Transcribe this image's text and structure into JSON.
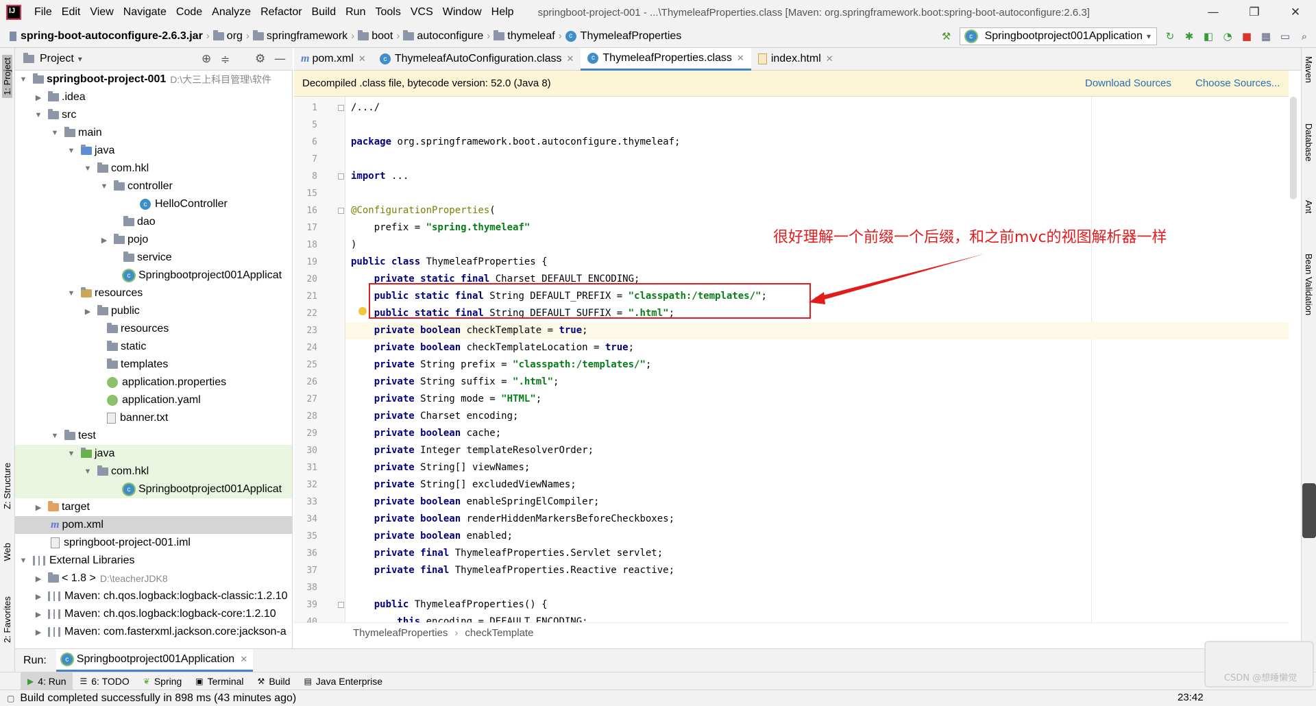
{
  "menubar": {
    "items": [
      "File",
      "Edit",
      "View",
      "Navigate",
      "Code",
      "Analyze",
      "Refactor",
      "Build",
      "Run",
      "Tools",
      "VCS",
      "Window",
      "Help"
    ],
    "title": "springboot-project-001 - ...\\ThymeleafProperties.class [Maven: org.springframework.boot:spring-boot-autoconfigure:2.6.3]"
  },
  "navbar": {
    "crumbs": [
      "spring-boot-autoconfigure-2.6.3.jar",
      "org",
      "springframework",
      "boot",
      "autoconfigure",
      "thymeleaf",
      "ThymeleafProperties"
    ],
    "run_config": "Springbootproject001Application"
  },
  "project": {
    "title": "Project",
    "nodes": [
      {
        "label": "springboot-project-001",
        "extra": "D:\\大三上科目管理\\软件"
      },
      {
        "label": ".idea"
      },
      {
        "label": "src"
      },
      {
        "label": "main"
      },
      {
        "label": "java"
      },
      {
        "label": "com.hkl"
      },
      {
        "label": "controller"
      },
      {
        "label": "HelloController"
      },
      {
        "label": "dao"
      },
      {
        "label": "pojo"
      },
      {
        "label": "service"
      },
      {
        "label": "Springbootproject001Applicat"
      },
      {
        "label": "resources"
      },
      {
        "label": "public"
      },
      {
        "label": "resources"
      },
      {
        "label": "static"
      },
      {
        "label": "templates"
      },
      {
        "label": "application.properties"
      },
      {
        "label": "application.yaml"
      },
      {
        "label": "banner.txt"
      },
      {
        "label": "test"
      },
      {
        "label": "java"
      },
      {
        "label": "com.hkl"
      },
      {
        "label": "Springbootproject001Applicat"
      },
      {
        "label": "target"
      },
      {
        "label": "pom.xml"
      },
      {
        "label": "springboot-project-001.iml"
      },
      {
        "label": "External Libraries"
      },
      {
        "label": "< 1.8 >",
        "extra": "D:\\teacherJDK8"
      },
      {
        "label": "Maven: ch.qos.logback:logback-classic:1.2.10"
      },
      {
        "label": "Maven: ch.qos.logback:logback-core:1.2.10"
      },
      {
        "label": "Maven: com.fasterxml.jackson.core:jackson-a"
      }
    ]
  },
  "tabs": [
    {
      "label": "pom.xml"
    },
    {
      "label": "ThymeleafAutoConfiguration.class"
    },
    {
      "label": "ThymeleafProperties.class"
    },
    {
      "label": "index.html"
    }
  ],
  "banner": {
    "text": "Decompiled .class file, bytecode version: 52.0 (Java 8)",
    "download": "Download Sources",
    "choose": "Choose Sources..."
  },
  "code": {
    "line_numbers": [
      "1",
      "5",
      "6",
      "7",
      "8",
      "15",
      "16",
      "17",
      "18",
      "19",
      "20",
      "21",
      "22",
      "23",
      "24",
      "25",
      "26",
      "27",
      "28",
      "29",
      "30",
      "31",
      "32",
      "33",
      "34",
      "35",
      "36",
      "37",
      "38",
      "39",
      "40"
    ],
    "lines": [
      [
        [
          "",
          "/.../"
        ]
      ],
      [],
      [
        [
          "k",
          "package "
        ],
        [
          "",
          "org.springframework.boot.autoconfigure.thymeleaf;"
        ]
      ],
      [],
      [
        [
          "k",
          "import "
        ],
        [
          "",
          "..."
        ]
      ],
      [],
      [
        [
          "a",
          "@ConfigurationProperties"
        ],
        [
          "",
          "("
        ]
      ],
      [
        [
          "",
          "    prefix = "
        ],
        [
          "s",
          "\"spring.thymeleaf\""
        ]
      ],
      [
        [
          "",
          ")"
        ]
      ],
      [
        [
          "k",
          "public class "
        ],
        [
          "",
          "ThymeleafProperties {"
        ]
      ],
      [
        [
          "k",
          "    private static final "
        ],
        [
          "",
          "Charset DEFAULT_ENCODING;"
        ]
      ],
      [
        [
          "k",
          "    public static final "
        ],
        [
          "",
          "String DEFAULT_PREFIX = "
        ],
        [
          "s",
          "\"classpath:/templates/\""
        ],
        [
          "",
          ";"
        ]
      ],
      [
        [
          "k",
          "    public static final "
        ],
        [
          "",
          "String DEFAULT_SUFFIX = "
        ],
        [
          "s",
          "\".html\""
        ],
        [
          "",
          ";"
        ]
      ],
      [
        [
          "k",
          "    private boolean "
        ],
        [
          "",
          "checkTemplate = "
        ],
        [
          "k",
          "true"
        ],
        [
          "",
          ";"
        ]
      ],
      [
        [
          "k",
          "    private boolean "
        ],
        [
          "",
          "checkTemplateLocation = "
        ],
        [
          "k",
          "true"
        ],
        [
          "",
          ";"
        ]
      ],
      [
        [
          "k",
          "    private "
        ],
        [
          "",
          "String prefix = "
        ],
        [
          "s",
          "\"classpath:/templates/\""
        ],
        [
          "",
          ";"
        ]
      ],
      [
        [
          "k",
          "    private "
        ],
        [
          "",
          "String suffix = "
        ],
        [
          "s",
          "\".html\""
        ],
        [
          "",
          ";"
        ]
      ],
      [
        [
          "k",
          "    private "
        ],
        [
          "",
          "String mode = "
        ],
        [
          "s",
          "\"HTML\""
        ],
        [
          "",
          ";"
        ]
      ],
      [
        [
          "k",
          "    private "
        ],
        [
          "",
          "Charset encoding;"
        ]
      ],
      [
        [
          "k",
          "    private boolean "
        ],
        [
          "",
          "cache;"
        ]
      ],
      [
        [
          "k",
          "    private "
        ],
        [
          "",
          "Integer templateResolverOrder;"
        ]
      ],
      [
        [
          "k",
          "    private "
        ],
        [
          "",
          "String[] viewNames;"
        ]
      ],
      [
        [
          "k",
          "    private "
        ],
        [
          "",
          "String[] excludedViewNames;"
        ]
      ],
      [
        [
          "k",
          "    private boolean "
        ],
        [
          "",
          "enableSpringElCompiler;"
        ]
      ],
      [
        [
          "k",
          "    private boolean "
        ],
        [
          "",
          "renderHiddenMarkersBeforeCheckboxes;"
        ]
      ],
      [
        [
          "k",
          "    private boolean "
        ],
        [
          "",
          "enabled;"
        ]
      ],
      [
        [
          "k",
          "    private final "
        ],
        [
          "",
          "ThymeleafProperties.Servlet servlet;"
        ]
      ],
      [
        [
          "k",
          "    private final "
        ],
        [
          "",
          "ThymeleafProperties.Reactive reactive;"
        ]
      ],
      [],
      [
        [
          "k",
          "    public "
        ],
        [
          "",
          "ThymeleafProperties() {"
        ]
      ],
      [
        [
          "k",
          "        this"
        ],
        [
          "",
          ".encoding = DEFAULT_ENCODING;"
        ]
      ]
    ]
  },
  "annotation": "很好理解一个前缀一个后缀，和之前mvc的视图解析器一样",
  "code_crumbs": [
    "ThymeleafProperties",
    "checkTemplate"
  ],
  "run": {
    "label": "Run:",
    "config": "Springbootproject001Application"
  },
  "toolwindows": [
    "4: Run",
    "6: TODO",
    "Spring",
    "Terminal",
    "Build",
    "Java Enterprise"
  ],
  "left_vtabs": [
    "1: Project",
    "Z: Structure",
    "Web",
    "2: Favorites"
  ],
  "right_vtabs": [
    "Maven",
    "Database",
    "Ant",
    "Bean Validation"
  ],
  "status": {
    "message": "Build completed successfully in 898 ms (43 minutes ago)",
    "time": "23:42"
  },
  "watermark": "CSDN @想睡懒觉"
}
